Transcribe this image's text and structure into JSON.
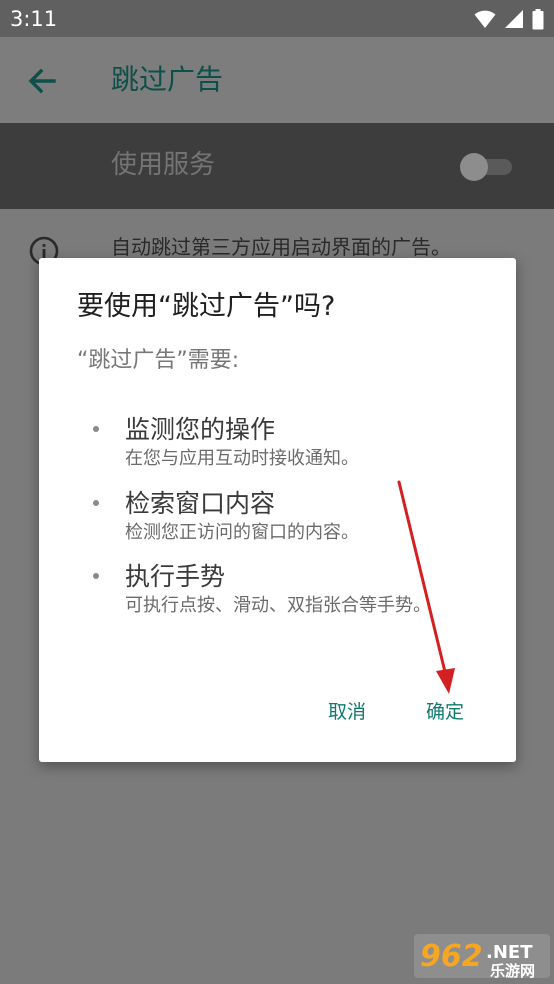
{
  "status_bar": {
    "time": "3:11",
    "icons": [
      "wifi-icon",
      "signal-icon",
      "battery-icon"
    ]
  },
  "app_bar": {
    "title": "跳过广告",
    "back_icon": "arrow-back-icon"
  },
  "service": {
    "label": "使用服务",
    "enabled": false
  },
  "info": {
    "text": "自动跳过第三方应用启动界面的广告。"
  },
  "dialog": {
    "title": "要使用“跳过广告”吗?",
    "subtitle": "“跳过广告”需要:",
    "permissions": [
      {
        "title": "监测您的操作",
        "desc": "在您与应用互动时接收通知。"
      },
      {
        "title": "检索窗口内容",
        "desc": "检测您正访问的窗口的内容。"
      },
      {
        "title": "执行手势",
        "desc": "可执行点按、滑动、双指张合等手势。"
      }
    ],
    "cancel": "取消",
    "confirm": "确定"
  },
  "watermark": {
    "brand": "962.NET",
    "sub": "乐游网"
  },
  "colors": {
    "accent": "#0f7a70",
    "annotation_arrow": "#d42020"
  }
}
